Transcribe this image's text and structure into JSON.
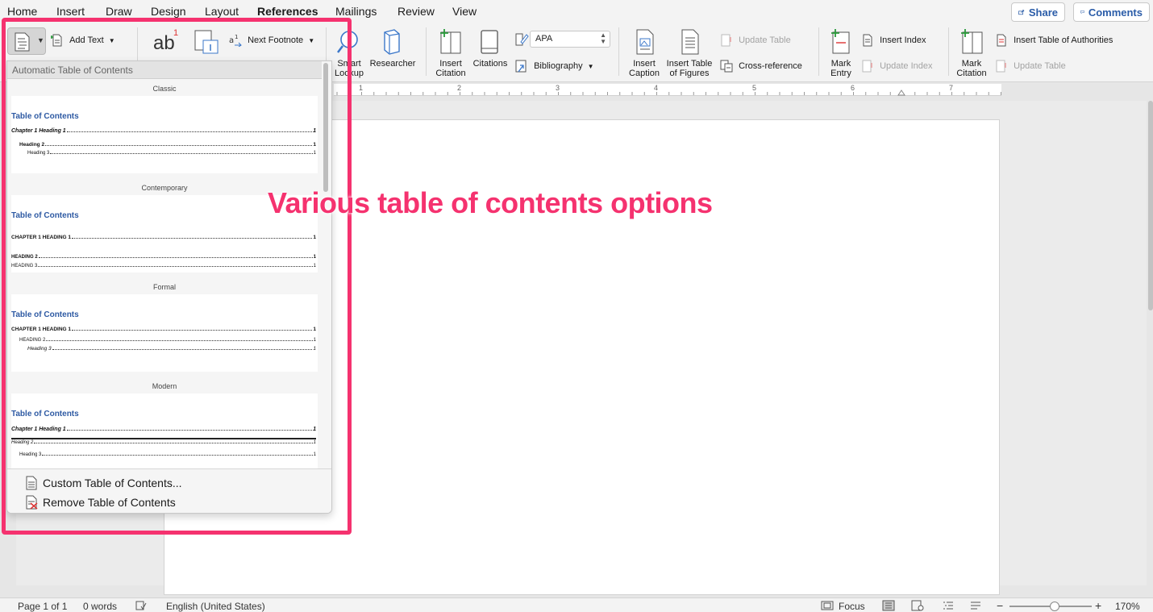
{
  "menu": {
    "tabs": [
      "Home",
      "Insert",
      "Draw",
      "Design",
      "Layout",
      "References",
      "Mailings",
      "Review",
      "View"
    ],
    "active_tab": "References",
    "share_label": "Share",
    "comments_label": "Comments"
  },
  "ribbon": {
    "add_text": "Add Text",
    "footnote_glyph": "ab",
    "footnote_superscript": "1",
    "next_footnote": "Next Footnote",
    "smart_lookup_1": "Smart",
    "smart_lookup_2": "Lookup",
    "researcher": "Researcher",
    "insert_citation_1": "Insert",
    "insert_citation_2": "Citation",
    "citations": "Citations",
    "citation_style": "APA",
    "bibliography": "Bibliography",
    "insert_caption_1": "Insert",
    "insert_caption_2": "Caption",
    "insert_table_figures_1": "Insert Table",
    "insert_table_figures_2": "of Figures",
    "update_table": "Update Table",
    "cross_reference": "Cross-reference",
    "mark_entry_1": "Mark",
    "mark_entry_2": "Entry",
    "insert_index": "Insert Index",
    "update_index": "Update Index",
    "mark_citation_1": "Mark",
    "mark_citation_2": "Citation",
    "insert_table_authorities": "Insert Table of Authorities",
    "update_table_authorities": "Update Table"
  },
  "ruler": {
    "numbers": [
      "1",
      "2",
      "3",
      "4",
      "5",
      "6",
      "7"
    ]
  },
  "toc": {
    "header": "Automatic Table of Contents",
    "styles": [
      {
        "name": "Classic",
        "title": "Table of Contents",
        "h1": "Chapter 1 Heading 1",
        "h2": "Heading 2",
        "h3": "Heading 3",
        "page": "1"
      },
      {
        "name": "Contemporary",
        "title": "Table of Contents",
        "h1": "CHAPTER 1 HEADING 1",
        "h2": "HEADING 2",
        "h3": "HEADING 3",
        "page": "1"
      },
      {
        "name": "Formal",
        "title": "Table of Contents",
        "h1": "CHAPTER 1 HEADING 1",
        "h2": "HEADING 2",
        "h3": "Heading 3",
        "page": "1"
      },
      {
        "name": "Modern",
        "title": "Table of Contents",
        "h1": "Chapter 1 Heading 1",
        "h2": "Heading 2",
        "h3": "Heading 3",
        "page": "1"
      }
    ],
    "custom_label": "Custom Table of Contents...",
    "remove_label": "Remove Table of Contents"
  },
  "annotation": "Various table of contents options",
  "status": {
    "page": "Page 1 of 1",
    "words": "0 words",
    "language": "English (United States)",
    "focus": "Focus",
    "zoom": "170%"
  },
  "colors": {
    "highlight": "#f5326f",
    "toc_title": "#2e5aa3",
    "accent": "#2a5ca8"
  }
}
